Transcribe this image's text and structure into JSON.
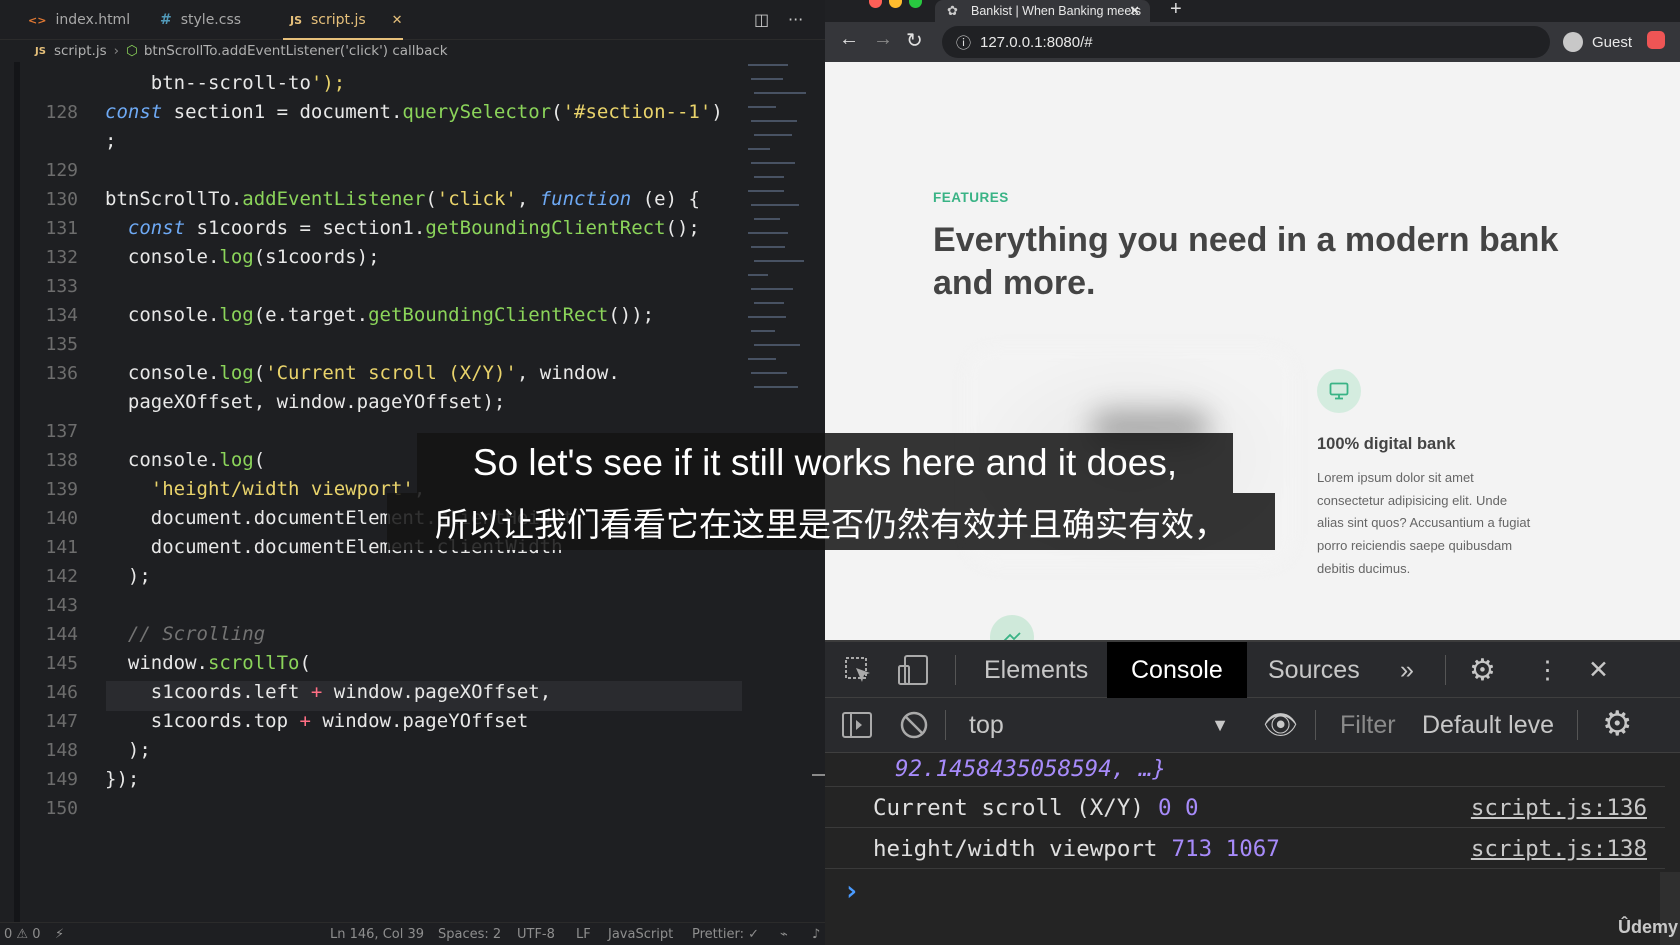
{
  "editor": {
    "tabs": [
      {
        "icon": "<>",
        "label": "index.html"
      },
      {
        "icon": "#",
        "label": "style.css"
      },
      {
        "icon": "JS",
        "label": "script.js",
        "close": "✕"
      }
    ],
    "breadcrumb": {
      "file": "script.js",
      "symbol": "btnScrollTo.addEventListener('click') callback"
    },
    "lines": [
      {
        "n": "",
        "t": "    btn--scroll-to');"
      },
      {
        "n": "128",
        "t": "const section1 = document.querySelector('#section--1')"
      },
      {
        "n": "",
        "t": ";"
      },
      {
        "n": "129",
        "t": ""
      },
      {
        "n": "130",
        "t": "btnScrollTo.addEventListener('click', function (e) {"
      },
      {
        "n": "131",
        "t": "  const s1coords = section1.getBoundingClientRect();"
      },
      {
        "n": "132",
        "t": "  console.log(s1coords);"
      },
      {
        "n": "133",
        "t": ""
      },
      {
        "n": "134",
        "t": "  console.log(e.target.getBoundingClientRect());"
      },
      {
        "n": "135",
        "t": ""
      },
      {
        "n": "136",
        "t": "  console.log('Current scroll (X/Y)', window."
      },
      {
        "n": "",
        "t": "  pageXOffset, window.pageYOffset);"
      },
      {
        "n": "137",
        "t": ""
      },
      {
        "n": "138",
        "t": "  console.log("
      },
      {
        "n": "139",
        "t": "    'height/width viewport',"
      },
      {
        "n": "140",
        "t": "    document.documentElement.clientHeight,"
      },
      {
        "n": "141",
        "t": "    document.documentElement.clientWidth"
      },
      {
        "n": "142",
        "t": "  );"
      },
      {
        "n": "143",
        "t": ""
      },
      {
        "n": "144",
        "t": "  // Scrolling"
      },
      {
        "n": "145",
        "t": "  window.scrollTo("
      },
      {
        "n": "146",
        "t": "    s1coords.left + window.pageXOffset,"
      },
      {
        "n": "147",
        "t": "    s1coords.top + window.pageYOffset"
      },
      {
        "n": "148",
        "t": "  );"
      },
      {
        "n": "149",
        "t": "});"
      },
      {
        "n": "150",
        "t": ""
      }
    ],
    "status": {
      "problems": "0 ⚠ 0",
      "cursor": "Ln 146, Col 39",
      "spaces": "Spaces: 2",
      "encoding": "UTF-8",
      "eol": "LF",
      "language": "JavaScript",
      "prettier": "Prettier: ✓"
    }
  },
  "browser": {
    "tab_title": "Bankist | When Banking meets",
    "url": "127.0.0.1:8080/#",
    "profile": "Guest",
    "page": {
      "eyebrow": "FEATURES",
      "headline": "Everything you need in a modern bank and more.",
      "feature_title": "100% digital bank",
      "feature_text": "Lorem ipsum dolor sit amet consectetur adipisicing elit. Unde alias sint quos? Accusantium a fugiat porro reiciendis saepe quibusdam debitis ducimus."
    },
    "devtools": {
      "tabs": [
        "Elements",
        "Console",
        "Sources"
      ],
      "context": "top",
      "filter_placeholder": "Filter",
      "levels": "Default leve",
      "console": [
        {
          "text": "92.1458435058594, …}",
          "nums": "",
          "link": ""
        },
        {
          "text": "Current scroll (X/Y)",
          "nums": "0 0",
          "link": "script.js:136"
        },
        {
          "text": "height/width viewport",
          "nums": "713 1067",
          "link": "script.js:138"
        }
      ],
      "prompt": "›"
    }
  },
  "subtitles": {
    "en": "So let's see if it still works here and it does,",
    "zh": "所以让我们看看它在这里是否仍然有效并且确实有效，"
  },
  "watermark": "Ûdemy"
}
